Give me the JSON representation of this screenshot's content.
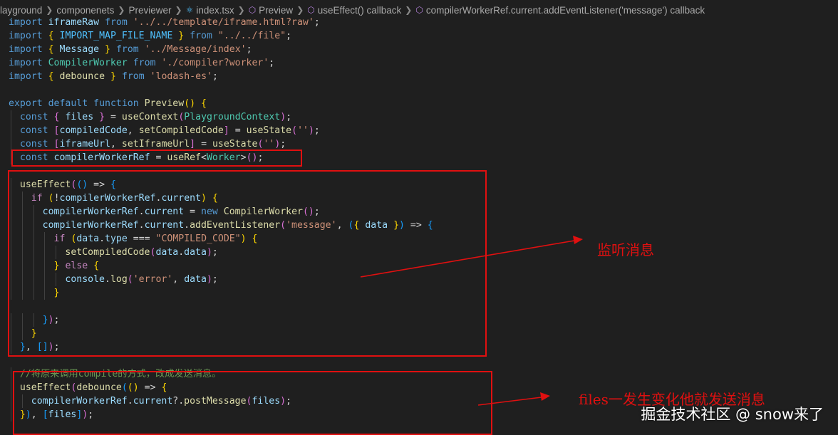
{
  "breadcrumb": {
    "items": [
      {
        "label": "layground",
        "icon": ""
      },
      {
        "label": "componenets",
        "icon": ""
      },
      {
        "label": "Previewer",
        "icon": ""
      },
      {
        "label": "index.tsx",
        "icon": "react-icon"
      },
      {
        "label": "Preview",
        "icon": "cube-icon"
      },
      {
        "label": "useEffect() callback",
        "icon": "cube-icon"
      },
      {
        "label": "compilerWorkerRef.current.addEventListener('message') callback",
        "icon": "cube-icon"
      }
    ]
  },
  "code_lines": [
    "import iframeRaw from '../../template/iframe.html?raw';",
    "import { IMPORT_MAP_FILE_NAME } from \"../../file\";",
    "import { Message } from '../Message/index';",
    "import CompilerWorker from './compiler?worker';",
    "import { debounce } from 'lodash-es';",
    "",
    "export default function Preview() {",
    "  const { files } = useContext(PlaygroundContext);",
    "  const [compiledCode, setCompiledCode] = useState('');",
    "  const [iframeUrl, setIframeUrl] = useState('');",
    "  const compilerWorkerRef = useRef<Worker>();",
    "",
    "  useEffect(() => {",
    "    if (!compilerWorkerRef.current) {",
    "      compilerWorkerRef.current = new CompilerWorker();",
    "      compilerWorkerRef.current.addEventListener('message', ({ data }) => {",
    "        if (data.type === \"COMPILED_CODE\") {",
    "          setCompiledCode(data.data);",
    "        } else {",
    "          console.log('error', data);",
    "        }",
    "",
    "      });",
    "    }",
    "  }, []);",
    "",
    "  //将原来调用compile的方式，改成发送消息。",
    "  useEffect(debounce(() => {",
    "    compilerWorkerRef.current?.postMessage(files);",
    "  }), [files]);"
  ],
  "annotations": {
    "listen": "监听消息",
    "send": "files一发生变化他就发送消息"
  },
  "watermark": "掘金技术社区 @ snow来了",
  "colors": {
    "background": "#1f1f1f",
    "annotation_red": "#e01010",
    "keyword": "#569cd6",
    "control": "#c586c0",
    "string": "#ce9178",
    "variable": "#9cdcfe",
    "function": "#dcdcaa",
    "type": "#4ec9b0",
    "comment": "#6a9955"
  }
}
